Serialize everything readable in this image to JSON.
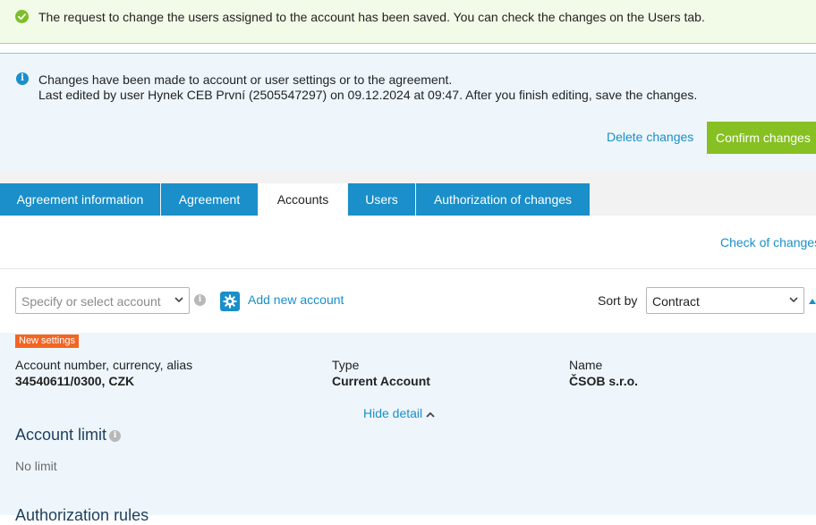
{
  "success_message": "The request to change the users assigned to the account has been saved. You can check the changes on the Users tab.",
  "info": {
    "line1": "Changes have been made to account or user settings or to the agreement.",
    "line2": "Last edited by user Hynek CEB První (2505547297) on 09.12.2024 at 09:47. After you finish editing, save the changes.",
    "delete_label": "Delete changes",
    "confirm_label": "Confirm changes"
  },
  "tabs": [
    {
      "label": "Agreement information"
    },
    {
      "label": "Agreement"
    },
    {
      "label": "Accounts"
    },
    {
      "label": "Users"
    },
    {
      "label": "Authorization of changes"
    }
  ],
  "active_tab": "Accounts",
  "check_changes_label": "Check of changes",
  "toolbar": {
    "account_placeholder": "Specify or select account",
    "add_account_label": "Add new account",
    "sort_label": "Sort by",
    "sort_value": "Contract"
  },
  "account": {
    "badge": "New settings",
    "columns": [
      {
        "label": "Account number, currency, alias",
        "value": "34540611/0300, CZK"
      },
      {
        "label": "Type",
        "value": "Current Account"
      },
      {
        "label": "Name",
        "value": "ČSOB s.r.o."
      }
    ],
    "hide_detail_label": "Hide detail",
    "limit_title": "Account limit",
    "limit_value": "No limit",
    "next_section_title": "Authorization rules"
  },
  "colors": {
    "accent_blue": "#1a8fc9",
    "confirm_green": "#86c022",
    "badge_orange": "#f26522",
    "success_bg": "#f2fbe7",
    "info_bg": "#eef6fc"
  },
  "icons": {
    "success": "check-circle-icon",
    "info": "info-icon",
    "gear": "gear-icon",
    "chevron": "chevron-down-icon",
    "hide": "chevron-up-icon"
  }
}
